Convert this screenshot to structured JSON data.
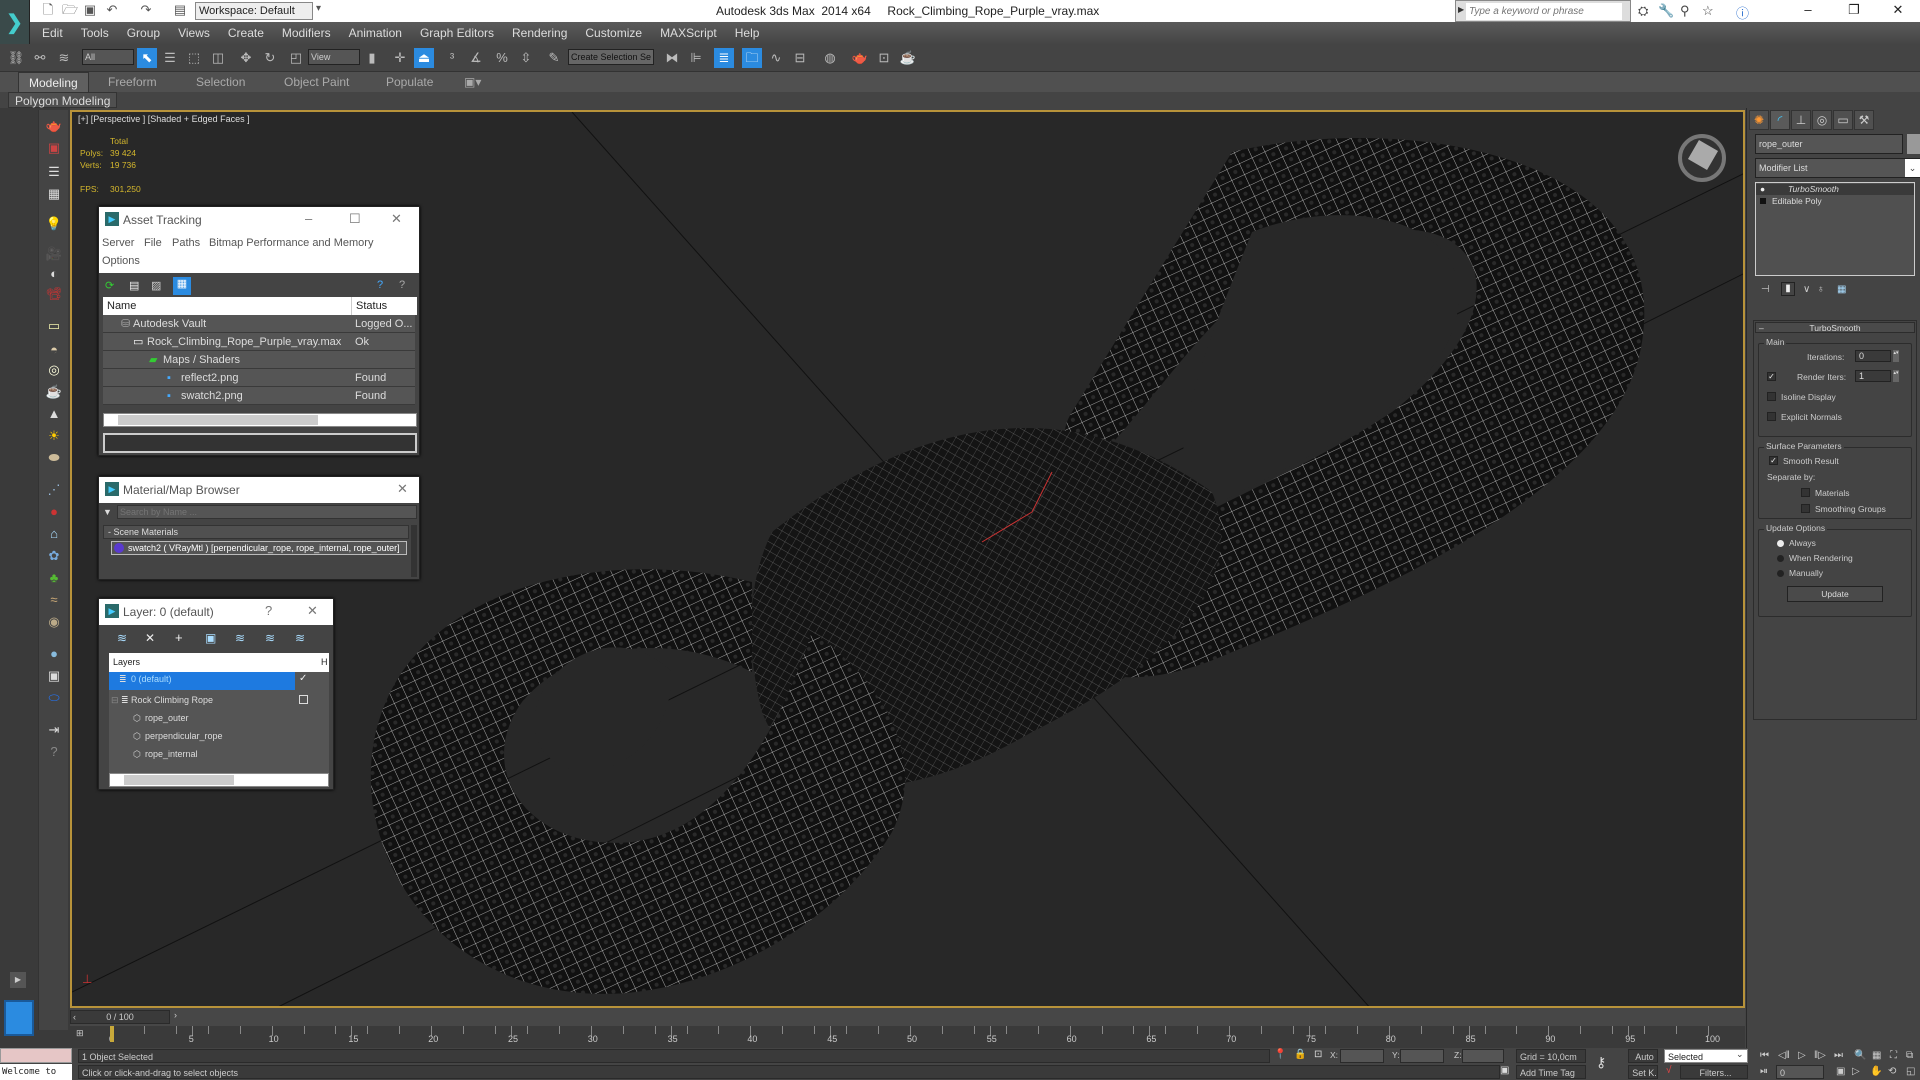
{
  "titlebar": {
    "workspace": "Workspace: Default",
    "app_title": "Autodesk 3ds Max  2014 x64     Rock_Climbing_Rope_Purple_vray.max",
    "search_placeholder": "Type a keyword or phrase",
    "min": "–",
    "max": "❐",
    "close": "✕"
  },
  "menu": [
    "Edit",
    "Tools",
    "Group",
    "Views",
    "Create",
    "Modifiers",
    "Animation",
    "Graph Editors",
    "Rendering",
    "Customize",
    "MAXScript",
    "Help"
  ],
  "toolbar": {
    "filter_select": "All",
    "refcoord_select": "View",
    "named_selection": "Create Selection Se"
  },
  "ribbon": {
    "tabs": [
      "Modeling",
      "Freeform",
      "Selection",
      "Object Paint",
      "Populate"
    ],
    "active_tab": "Modeling",
    "panel": "Polygon Modeling"
  },
  "viewport": {
    "label": "[+] [Perspective ] [Shaded + Edged Faces ]",
    "stats": {
      "header": "Total",
      "polys_label": "Polys:",
      "polys": "39 424",
      "verts_label": "Verts:",
      "verts": "19 736",
      "fps_label": "FPS:",
      "fps": "301,250"
    }
  },
  "asset_tracking": {
    "title": "Asset Tracking",
    "menu": [
      "Server",
      "File",
      "Paths",
      "Bitmap Performance and Memory",
      "Options"
    ],
    "columns": [
      "Name",
      "Status"
    ],
    "rows": [
      {
        "name": "Autodesk Vault",
        "status": "Logged O..."
      },
      {
        "name": "Rock_Climbing_Rope_Purple_vray.max",
        "status": "Ok"
      },
      {
        "name": "Maps / Shaders",
        "status": ""
      },
      {
        "name": "reflect2.png",
        "status": "Found"
      },
      {
        "name": "swatch2.png",
        "status": "Found"
      }
    ]
  },
  "material_browser": {
    "title": "Material/Map Browser",
    "search_placeholder": "Search by Name ...",
    "group": "- Scene Materials",
    "item": "swatch2  ( VRayMtl ) [perpendicular_rope, rope_internal, rope_outer]"
  },
  "layer_window": {
    "title": "Layer: 0 (default)",
    "help": "?",
    "column": "Layers",
    "column2": "H",
    "layers": [
      {
        "name": "0 (default)",
        "selected": true
      },
      {
        "name": "Rock Climbing Rope",
        "selected": false
      },
      {
        "name": "rope_outer",
        "selected": false
      },
      {
        "name": "perpendicular_rope",
        "selected": false
      },
      {
        "name": "rope_internal",
        "selected": false
      }
    ]
  },
  "command_panel": {
    "object_name": "rope_outer",
    "modifier_list": "Modifier List",
    "stack": [
      "TurboSmooth",
      "Editable Poly"
    ],
    "rollout_title": "TurboSmooth",
    "main_group": "Main",
    "iterations_label": "Iterations:",
    "iterations": "0",
    "render_iters_label": "Render Iters:",
    "render_iters": "1",
    "render_iters_checked": true,
    "isoline_display": "Isoline Display",
    "explicit_normals": "Explicit Normals",
    "surface_group": "Surface Parameters",
    "smooth_result": "Smooth Result",
    "separate_by": "Separate by:",
    "materials": "Materials",
    "smoothing_groups": "Smoothing Groups",
    "update_group": "Update Options",
    "update_options": [
      "Always",
      "When Rendering",
      "Manually"
    ],
    "update_selected": "Always",
    "update_button": "Update"
  },
  "timeline": {
    "frame": "0 / 100",
    "ticks": [
      "0",
      "5",
      "10",
      "15",
      "20",
      "25",
      "30",
      "35",
      "40",
      "45",
      "50",
      "55",
      "60",
      "65",
      "70",
      "75",
      "80",
      "85",
      "90",
      "95",
      "100"
    ]
  },
  "statusbar": {
    "maxscript": "Welcome to",
    "selected": "1 Object Selected",
    "prompt": "Click or click-and-drag to select objects",
    "x_label": "X:",
    "y_label": "Y:",
    "z_label": "Z:",
    "grid": "Grid = 10,0cm",
    "add_time_tag": "Add Time Tag",
    "auto": "Auto",
    "setk": "Set K.",
    "key_filter": "Selected",
    "filters": "Filters...",
    "current_frame": "0"
  }
}
